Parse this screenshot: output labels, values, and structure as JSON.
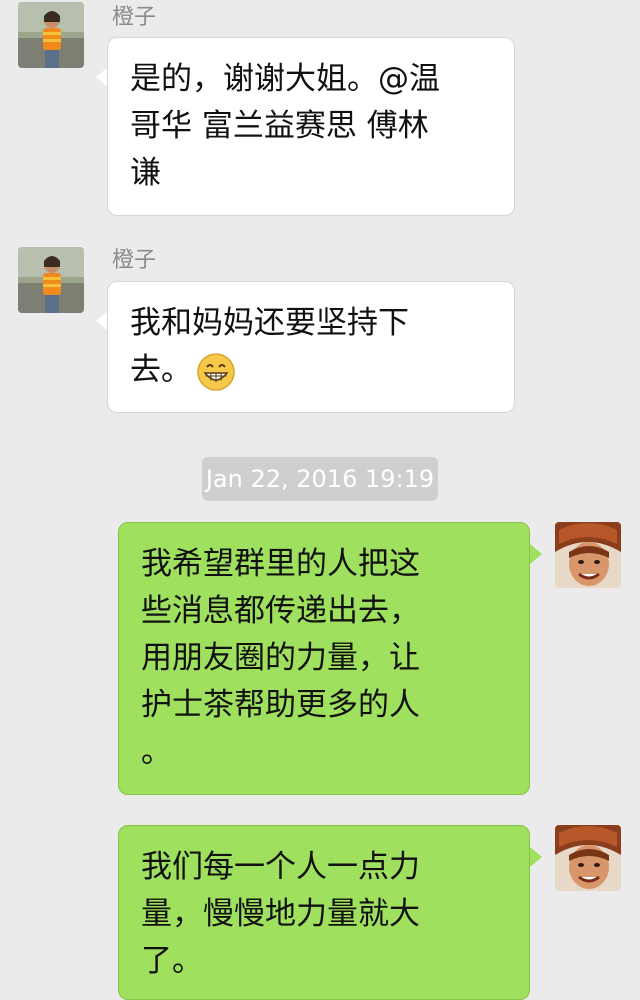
{
  "messages": [
    {
      "direction": "incoming",
      "sender": "橙子",
      "lines": [
        "是的，谢谢大姐。@温",
        "哥华 富兰益赛思 傅林",
        "谦"
      ]
    },
    {
      "direction": "incoming",
      "sender": "橙子",
      "lines": [
        "我和妈妈还要坚持下",
        "去。"
      ],
      "emoji": "grinning-face-emoji"
    },
    {
      "direction": "outgoing",
      "lines": [
        "我希望群里的人把这",
        "些消息都传递出去，",
        "用朋友圈的力量，让",
        "护士茶帮助更多的人",
        "。"
      ]
    },
    {
      "direction": "outgoing",
      "lines": [
        "我们每一个人一点力",
        "量，慢慢地力量就大",
        "了。"
      ]
    }
  ],
  "timestamp": "Jan 22, 2016 19:19",
  "colors": {
    "background": "#ebebeb",
    "incoming_bubble": "#ffffff",
    "outgoing_bubble": "#9fe05e",
    "timestamp_bg": "#cfcfcf",
    "sender_name": "#8a8a8a"
  }
}
